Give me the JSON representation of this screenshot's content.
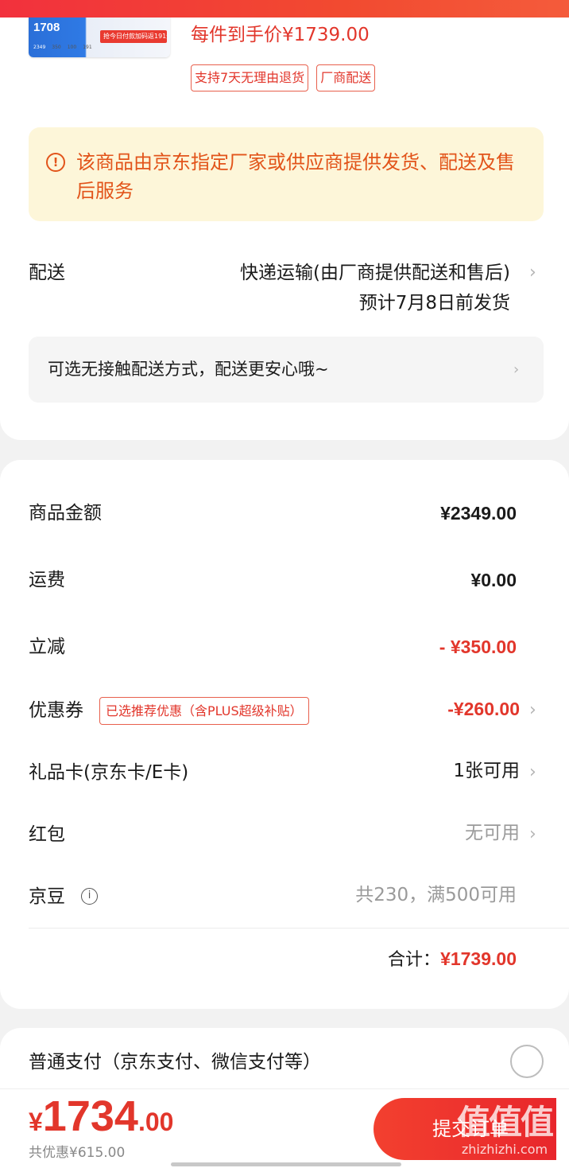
{
  "colors": {
    "accent_red": "#e2362b",
    "notice_bg": "#fdf6d9",
    "notice_text": "#e2541a"
  },
  "product": {
    "thumb_price": "1708",
    "thumb_promo": "抢今日付款加码返191元",
    "thumb_stats": [
      "2349",
      "350",
      "100",
      "191"
    ],
    "each_price": "每件到手价¥1739.00",
    "tags": [
      "支持7天无理由退货",
      "厂商配送"
    ]
  },
  "notice": {
    "icon": "info-circle-icon",
    "text": "该商品由京东指定厂家或供应商提供发货、配送及售后服务"
  },
  "delivery": {
    "label": "配送",
    "method": "快递运输(由厂商提供配送和售后)",
    "eta": "预计7月8日前发货",
    "contactless": "可选无接触配送方式，配送更安心哦~"
  },
  "summary": {
    "goods_amount": {
      "label": "商品金额",
      "value": "¥2349.00"
    },
    "shipping": {
      "label": "运费",
      "value": "¥0.00"
    },
    "instant_discount": {
      "label": "立减",
      "value": "- ¥350.00"
    },
    "coupon": {
      "label": "优惠券",
      "tag": "已选推荐优惠（含PLUS超级补贴）",
      "value": "-¥260.00"
    },
    "gift_card": {
      "label": "礼品卡(京东卡/E卡)",
      "value": "1张可用"
    },
    "red_packet": {
      "label": "红包",
      "value": "无可用"
    },
    "jd_beans": {
      "label": "京豆",
      "info_symbol": "i",
      "value": "共230，满500可用"
    },
    "total_label": "合计：",
    "total_value": "¥1739.00"
  },
  "payment": {
    "label": "普通支付（京东支付、微信支付等）"
  },
  "bottom": {
    "currency": "¥",
    "price_int": "1734",
    "price_dec": ".00",
    "saved": "共优惠¥615.00",
    "submit": "提交订单"
  },
  "watermark": {
    "logo": "值值值",
    "url": "zhizhizhi.com"
  }
}
